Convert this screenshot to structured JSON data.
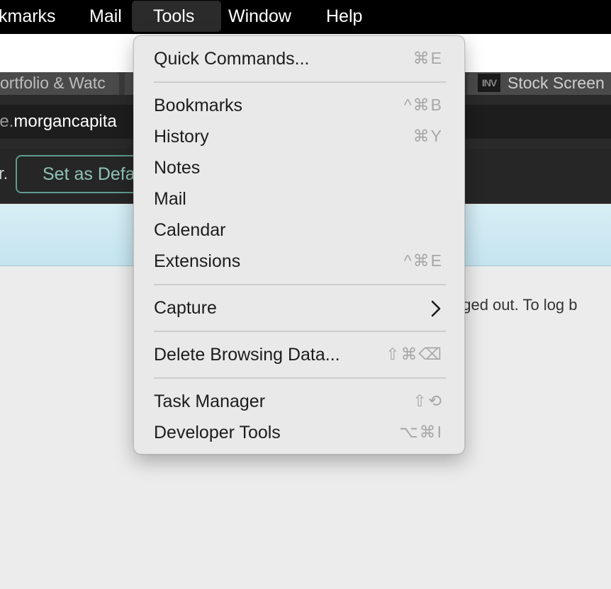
{
  "menubar": {
    "items": [
      "kmarks",
      "Mail",
      "Tools",
      "Window",
      "Help"
    ],
    "active": "Tools"
  },
  "tabs": {
    "left": "ortfolio & Watc",
    "right_icon": "INV",
    "right": "Stock Screen"
  },
  "address": {
    "prefix": "le.",
    "host": "morgancapita"
  },
  "infobar": {
    "text": "r.",
    "button": "Set as Defa"
  },
  "page": {
    "message": "gged out. To log b"
  },
  "menu": {
    "items": [
      {
        "label": "Quick Commands...",
        "shortcut": "⌘E"
      },
      {
        "label": "Bookmarks",
        "shortcut": "^⌘B"
      },
      {
        "label": "History",
        "shortcut": "⌘Y"
      },
      {
        "label": "Notes",
        "shortcut": ""
      },
      {
        "label": "Mail",
        "shortcut": ""
      },
      {
        "label": "Calendar",
        "shortcut": ""
      },
      {
        "label": "Extensions",
        "shortcut": "^⌘E"
      },
      {
        "label": "Capture",
        "shortcut": "",
        "submenu_icon": "chevron-right-icon"
      },
      {
        "label": "Delete Browsing Data...",
        "shortcut": "⇧⌘⌫"
      },
      {
        "label": "Task Manager",
        "shortcut": "⇧⟲"
      },
      {
        "label": "Developer Tools",
        "shortcut": "⌥⌘I"
      }
    ]
  },
  "colors": {
    "menubar_bg": "#000000",
    "menu_bg": "#e9e9e9",
    "accent_button": "#5f9c8f",
    "banner": "#cfe9f3"
  }
}
